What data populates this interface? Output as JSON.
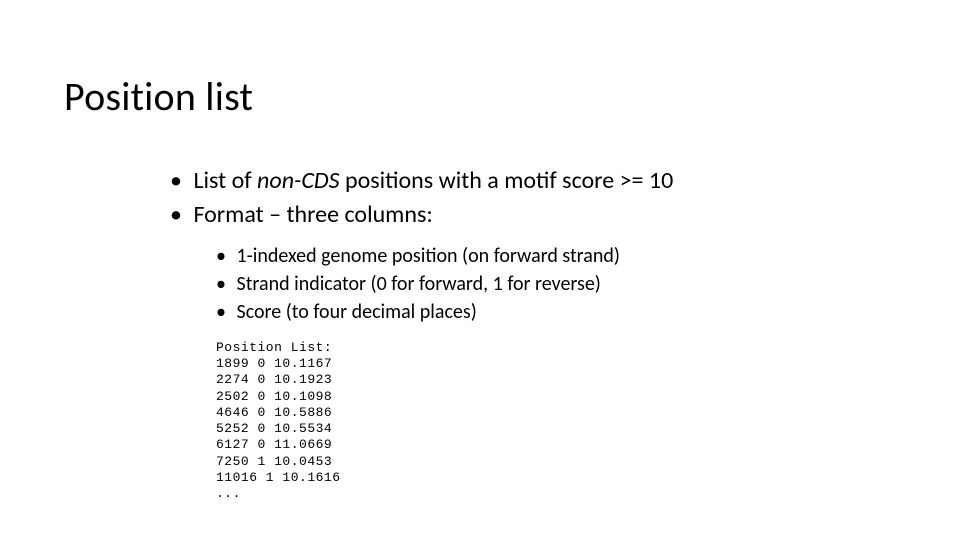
{
  "title": "Position list",
  "bullets": {
    "l1": [
      {
        "prefix": "List of ",
        "em": "non-CDS",
        "suffix": " positions with a motif score >= 10"
      },
      {
        "prefix": "Format – three columns:",
        "em": "",
        "suffix": ""
      }
    ],
    "l2": [
      "1-indexed genome position (on forward strand)",
      "Strand indicator (0 for forward, 1 for reverse)",
      "Score (to four decimal places)"
    ]
  },
  "code": {
    "header": "Position List:",
    "rows": [
      {
        "pos": "1899",
        "strand": "0",
        "score": "10.1167"
      },
      {
        "pos": "2274",
        "strand": "0",
        "score": "10.1923"
      },
      {
        "pos": "2502",
        "strand": "0",
        "score": "10.1098"
      },
      {
        "pos": "4646",
        "strand": "0",
        "score": "10.5886"
      },
      {
        "pos": "5252",
        "strand": "0",
        "score": "10.5534"
      },
      {
        "pos": "6127",
        "strand": "0",
        "score": "11.0669"
      },
      {
        "pos": "7250",
        "strand": "1",
        "score": "10.0453"
      },
      {
        "pos": "11016",
        "strand": "1",
        "score": "10.1616"
      }
    ],
    "ellipsis": "..."
  }
}
